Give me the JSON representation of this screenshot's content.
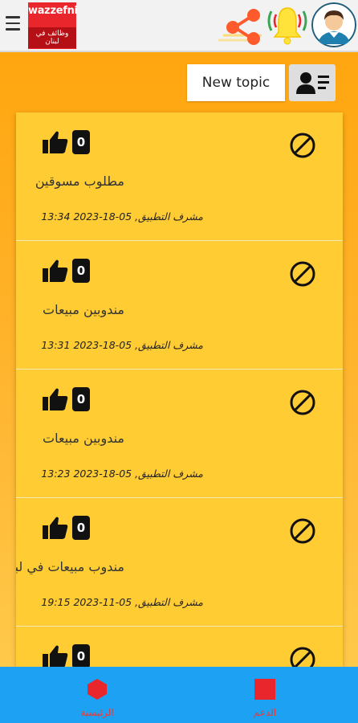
{
  "header": {
    "logo_word": "wazzefni",
    "logo_sub": "وظائف في لبنان"
  },
  "toolbar": {
    "new_topic_label": "New topic"
  },
  "topics": [
    {
      "likes": "0",
      "title": "مطلوب مسوقين",
      "meta": "مشرف التطبيق, 05-18-2023 13:34"
    },
    {
      "likes": "0",
      "title": "مندوبين مبيعات",
      "meta": "مشرف التطبيق, 05-18-2023 13:31"
    },
    {
      "likes": "0",
      "title": "مندوبين مبيعات",
      "meta": "مشرف التطبيق, 05-18-2023 13:23"
    },
    {
      "likes": "0",
      "title": "مندوب مبيعات في لبنان",
      "meta": "مشرف التطبيق, 05-11-2023 19:15"
    },
    {
      "likes": "0",
      "title": "",
      "meta": ""
    }
  ],
  "bottom_nav": {
    "home_label": "الرئيسية",
    "support_label": "الدعم"
  },
  "icons": {
    "menu": "menu-icon",
    "share": "share-icon",
    "bell": "bell-icon",
    "avatar": "avatar-icon",
    "like": "thumbs-up-icon",
    "block": "block-icon",
    "user_list": "user-list-icon",
    "home": "home-icon",
    "support": "support-icon"
  },
  "colors": {
    "page_background": "#ffa315",
    "card": "#ffcc33",
    "logo_red": "#e8262c",
    "nav_blue": "#1da1f2",
    "nav_label": "#e83a3a",
    "share": "#ff5a2b",
    "bell": "#ffe23a"
  }
}
